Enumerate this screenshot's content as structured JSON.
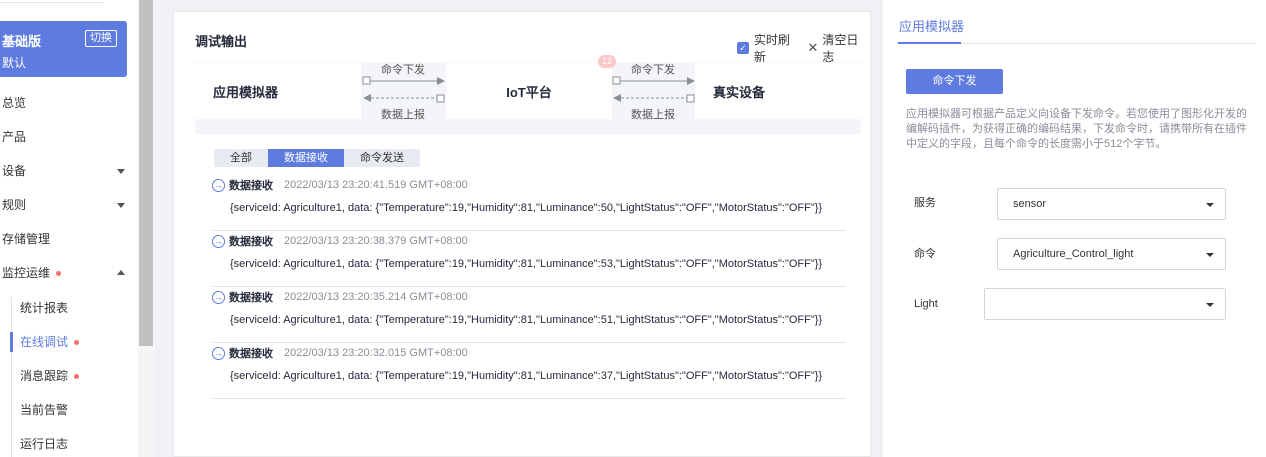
{
  "sidebar": {
    "edition": {
      "name": "基础版",
      "switch_label": "切换",
      "sub": "默认"
    },
    "items": [
      {
        "label": "总览"
      },
      {
        "label": "产品"
      },
      {
        "label": "设备"
      },
      {
        "label": "规则"
      },
      {
        "label": "存储管理"
      },
      {
        "label": "监控运维"
      }
    ],
    "sub_items": [
      {
        "label": "统计报表"
      },
      {
        "label": "在线调试"
      },
      {
        "label": "消息跟踪"
      },
      {
        "label": "当前告警"
      },
      {
        "label": "运行日志"
      }
    ]
  },
  "main": {
    "title": "调试输出",
    "realtime_refresh_label": "实时刷新",
    "realtime_refresh_checked": true,
    "clear_log_label": "清空日志",
    "flow": {
      "app_simulator": "应用模拟器",
      "iot_platform": "IoT平台",
      "real_device": "真实设备",
      "cmd_down_1": "命令下发",
      "data_up_1": "数据上报",
      "cmd_down_2": "命令下发",
      "data_up_2": "数据上报",
      "badge": "12"
    },
    "tabs": [
      {
        "label": "全部"
      },
      {
        "label": "数据接收"
      },
      {
        "label": "命令发送"
      }
    ],
    "active_tab": "数据接收",
    "logs": [
      {
        "type": "数据接收",
        "time": "2022/03/13 23:20:41.519 GMT+08:00",
        "body": "{serviceId: Agriculture1, data: {\"Temperature\":19,\"Humidity\":81,\"Luminance\":50,\"LightStatus\":\"OFF\",\"MotorStatus\":\"OFF\"}}"
      },
      {
        "type": "数据接收",
        "time": "2022/03/13 23:20:38.379 GMT+08:00",
        "body": "{serviceId: Agriculture1, data: {\"Temperature\":19,\"Humidity\":81,\"Luminance\":53,\"LightStatus\":\"OFF\",\"MotorStatus\":\"OFF\"}}"
      },
      {
        "type": "数据接收",
        "time": "2022/03/13 23:20:35.214 GMT+08:00",
        "body": "{serviceId: Agriculture1, data: {\"Temperature\":19,\"Humidity\":81,\"Luminance\":51,\"LightStatus\":\"OFF\",\"MotorStatus\":\"OFF\"}}"
      },
      {
        "type": "数据接收",
        "time": "2022/03/13 23:20:32.015 GMT+08:00",
        "body": "{serviceId: Agriculture1, data: {\"Temperature\":19,\"Humidity\":81,\"Luminance\":37,\"LightStatus\":\"OFF\",\"MotorStatus\":\"OFF\"}}"
      }
    ]
  },
  "right": {
    "tab": "应用模拟器",
    "send_button": "命令下发",
    "description": "应用模拟器可根据产品定义向设备下发命令。若您使用了图形化开发的编解码插件，为获得正确的编码结果，下发命令时，请携带所有在插件中定义的字段，且每个命令的长度需小于512个字节。",
    "service_label": "服务",
    "service_value": "sensor",
    "command_label": "命令",
    "command_value": "Agriculture_Control_light",
    "light_label": "Light",
    "light_value": ""
  },
  "colors": {
    "accent": "#5e7ce0",
    "dot": "#f66f6a"
  }
}
